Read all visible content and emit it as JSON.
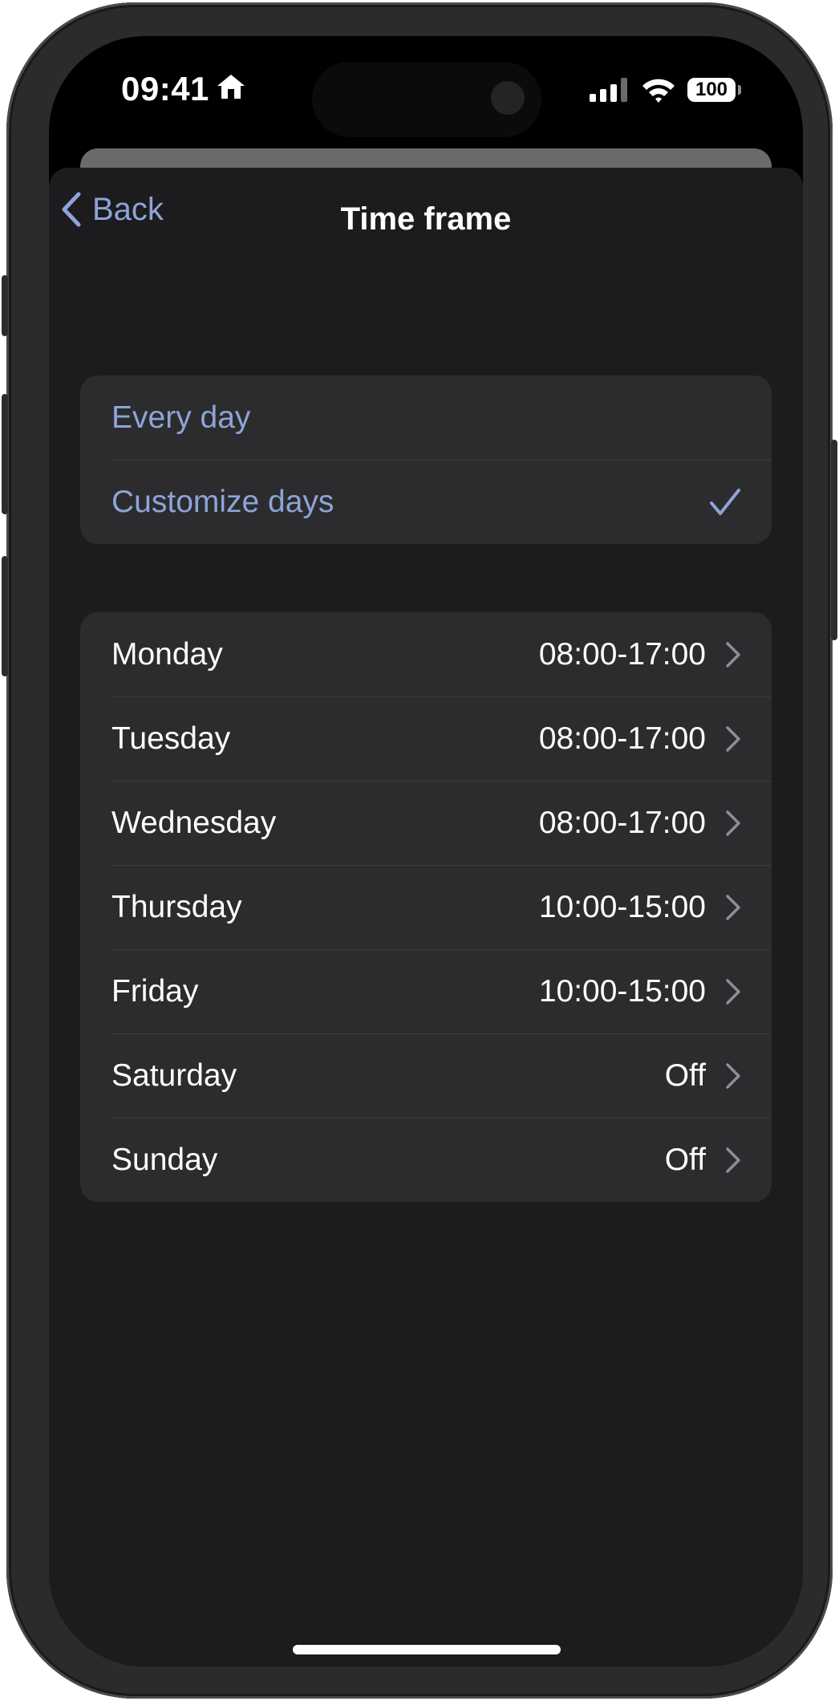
{
  "status_bar": {
    "time": "09:41",
    "battery_level": "100"
  },
  "nav": {
    "back_label": "Back",
    "title": "Time frame"
  },
  "frequency_options": [
    {
      "label": "Every day",
      "selected": false
    },
    {
      "label": "Customize days",
      "selected": true
    }
  ],
  "days": [
    {
      "day": "Monday",
      "hours": "08:00-17:00"
    },
    {
      "day": "Tuesday",
      "hours": "08:00-17:00"
    },
    {
      "day": "Wednesday",
      "hours": "08:00-17:00"
    },
    {
      "day": "Thursday",
      "hours": "10:00-15:00"
    },
    {
      "day": "Friday",
      "hours": "10:00-15:00"
    },
    {
      "day": "Saturday",
      "hours": "Off"
    },
    {
      "day": "Sunday",
      "hours": "Off"
    }
  ],
  "colors": {
    "accent": "#8da4d8",
    "background": "#1c1c1e",
    "cell": "#2c2c2e",
    "chevron": "#8e8e93"
  }
}
